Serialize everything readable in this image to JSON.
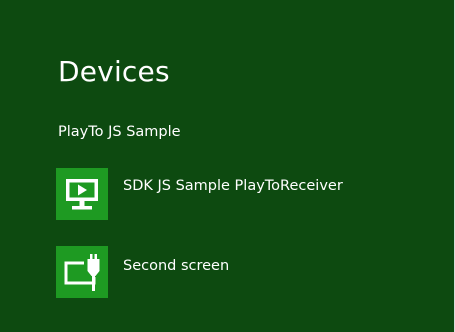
{
  "pane": {
    "title": "Devices",
    "subtitle": "PlayTo JS Sample",
    "background": "#0d4a10",
    "tile_color": "#1e9a22"
  },
  "devices": [
    {
      "label": "SDK JS Sample PlayToReceiver",
      "icon": "media-player-monitor-icon"
    },
    {
      "label": "Second screen",
      "icon": "second-screen-cable-icon"
    }
  ]
}
